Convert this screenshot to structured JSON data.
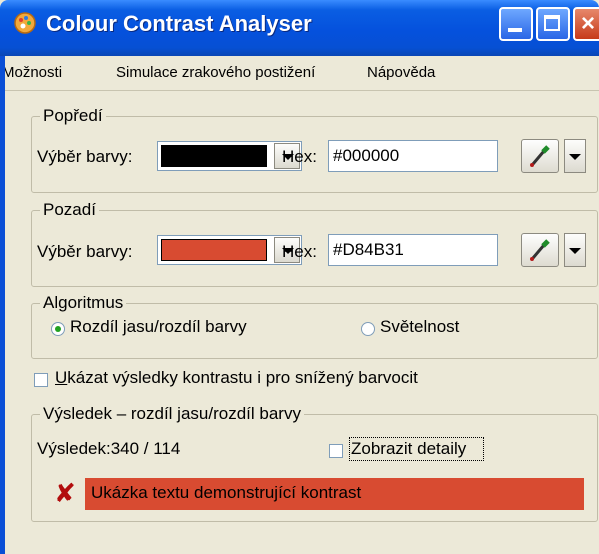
{
  "window": {
    "title": "Colour Contrast Analyser",
    "icon": "palette-icon",
    "controls": {
      "minimize": "minimize-icon",
      "maximize": "maximize-icon",
      "close": "×"
    }
  },
  "menu": {
    "items": [
      "Možnosti",
      "Simulace zrakového postižení",
      "Nápověda"
    ]
  },
  "foreground": {
    "legend": "Popředí",
    "color_label": "Výběr barvy:",
    "swatch_color": "#000000",
    "hex_label": "Hex:",
    "hex_value": "#000000",
    "picker_icon": "eyedropper-icon"
  },
  "background": {
    "legend": "Pozadí",
    "color_label": "Výběr barvy:",
    "swatch_color": "#D84B31",
    "hex_label": "Hex:",
    "hex_value": "#D84B31",
    "picker_icon": "eyedropper-icon"
  },
  "algorithm": {
    "legend": "Algoritmus",
    "options": [
      "Rozdíl jasu/rozdíl barvy",
      "Světelnost"
    ],
    "selected": "Rozdíl jasu/rozdíl barvy"
  },
  "color_blind_check": {
    "label_prefix": "U",
    "label_rest": "kázat výsledky kontrastu i pro snížený barvocit",
    "checked": false
  },
  "result": {
    "legend": "Výsledek – rozdíl  jasu/rozdíl barvy",
    "value_text": "Výsledek:340 / 114",
    "details_label": "Zobrazit detaily",
    "details_checked": false,
    "status_icon": "fail-x-icon",
    "status_glyph": "✘",
    "sample_text": "Ukázka textu demonstrující kontrast",
    "sample_bg": "#D84B31",
    "sample_fg": "#000000"
  },
  "colors": {
    "titlebar": "#0551dd",
    "window_bg": "#ece9d8"
  }
}
